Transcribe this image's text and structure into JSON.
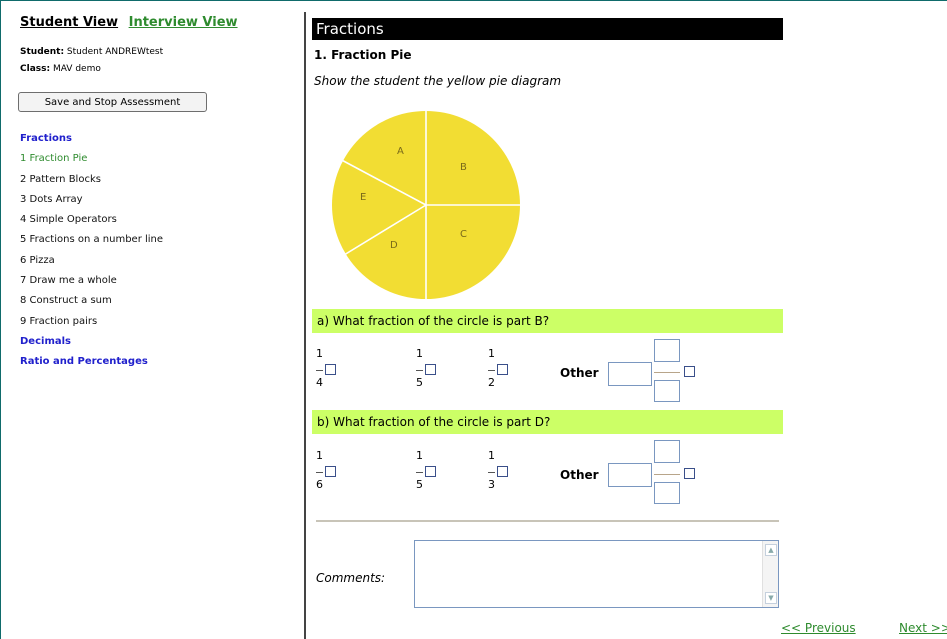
{
  "views": {
    "student": "Student View",
    "interview": "Interview View"
  },
  "info": {
    "student_label": "Student:",
    "student_value": "Student ANDREWtest",
    "class_label": "Class:",
    "class_value": "MAV demo"
  },
  "save_button": "Save and Stop Assessment",
  "nav": {
    "section_fractions": "Fractions",
    "items": [
      "1 Fraction Pie",
      "2 Pattern Blocks",
      "3 Dots Array",
      "4 Simple Operators",
      "5 Fractions on a number line",
      "6 Pizza",
      "7 Draw me a whole",
      "8 Construct a sum",
      "9 Fraction pairs"
    ],
    "section_decimals": "Decimals",
    "section_ratio": "Ratio and Percentages"
  },
  "main": {
    "header": "Fractions",
    "question_title": "1.  Fraction Pie",
    "instruction": "Show the student the yellow pie diagram",
    "pie_labels": {
      "a": "A",
      "b": "B",
      "c": "C",
      "d": "D",
      "e": "E"
    },
    "pie_color": "#f2dd33",
    "qa": {
      "text": "a) What fraction of the circle is part B?",
      "options": [
        {
          "num": "1",
          "den": "4"
        },
        {
          "num": "1",
          "den": "5"
        },
        {
          "num": "1",
          "den": "2"
        }
      ],
      "other": "Other"
    },
    "qb": {
      "text": "b) What fraction of the circle is part D?",
      "options": [
        {
          "num": "1",
          "den": "6"
        },
        {
          "num": "1",
          "den": "5"
        },
        {
          "num": "1",
          "den": "3"
        }
      ],
      "other": "Other"
    },
    "comments_label": "Comments:",
    "comments_value": ""
  },
  "footer": {
    "previous": "<< Previous",
    "next": "Next >>"
  },
  "colors": {
    "question_bar": "#ccff66",
    "link": "#2e8b2e",
    "section": "#2020cc"
  }
}
